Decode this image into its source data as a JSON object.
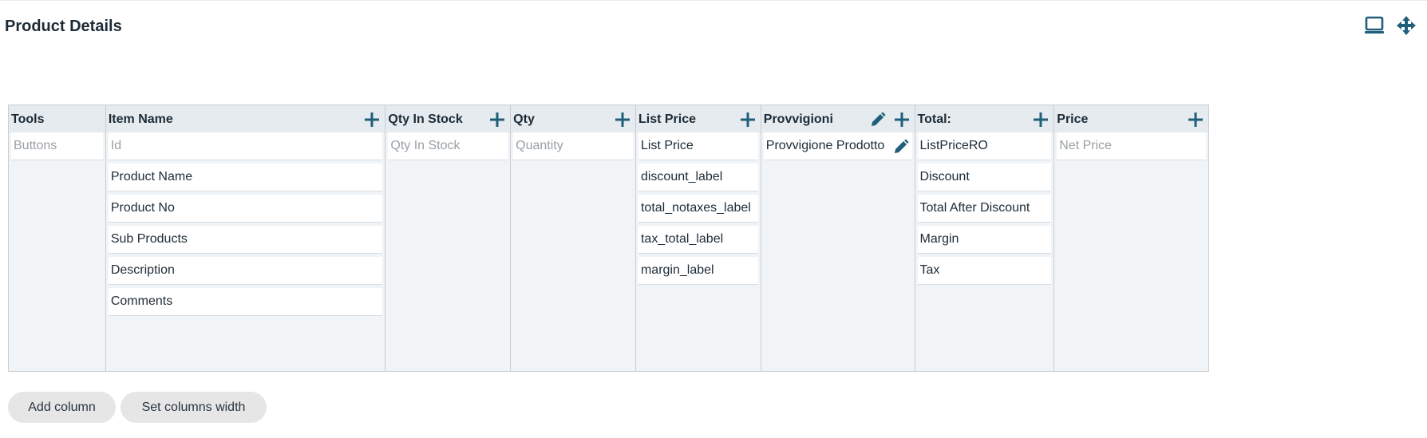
{
  "page": {
    "title": "Product Details"
  },
  "toolbar": {
    "icons": [
      "laptop-icon",
      "move-arrows-icon"
    ],
    "accent": "#1f5f7a"
  },
  "columns": [
    {
      "title": "Tools",
      "has_add": false,
      "has_edit": false,
      "cells": [
        {
          "text": "Buttons",
          "placeholder": true
        }
      ]
    },
    {
      "title": "Item Name",
      "has_add": true,
      "has_edit": false,
      "cells": [
        {
          "text": "Id",
          "placeholder": true
        },
        {
          "text": "Product Name"
        },
        {
          "text": "Product No"
        },
        {
          "text": "Sub Products"
        },
        {
          "text": "Description"
        },
        {
          "text": "Comments"
        }
      ]
    },
    {
      "title": "Qty In Stock",
      "has_add": true,
      "has_edit": false,
      "cells": [
        {
          "text": "Qty In Stock",
          "placeholder": true
        }
      ]
    },
    {
      "title": "Qty",
      "has_add": true,
      "has_edit": false,
      "cells": [
        {
          "text": "Quantity",
          "placeholder": true
        }
      ]
    },
    {
      "title": "List Price",
      "has_add": true,
      "has_edit": false,
      "cells": [
        {
          "text": "List Price"
        },
        {
          "text": "discount_label"
        },
        {
          "text": "total_notaxes_label"
        },
        {
          "text": "tax_total_label"
        },
        {
          "text": "margin_label"
        }
      ]
    },
    {
      "title": "Provvigioni",
      "has_add": true,
      "has_edit": true,
      "cells": [
        {
          "text": "Provvigione Prodotto",
          "editable": true
        }
      ]
    },
    {
      "title": "Total:",
      "has_add": true,
      "has_edit": false,
      "cells": [
        {
          "text": "ListPriceRO"
        },
        {
          "text": "Discount"
        },
        {
          "text": "Total After Discount"
        },
        {
          "text": "Margin"
        },
        {
          "text": "Tax"
        }
      ]
    },
    {
      "title": "Price",
      "has_add": true,
      "has_edit": false,
      "cells": [
        {
          "text": "Net Price",
          "placeholder": true
        }
      ]
    }
  ],
  "footer": {
    "add_column_label": "Add column",
    "set_width_label": "Set columns width"
  }
}
